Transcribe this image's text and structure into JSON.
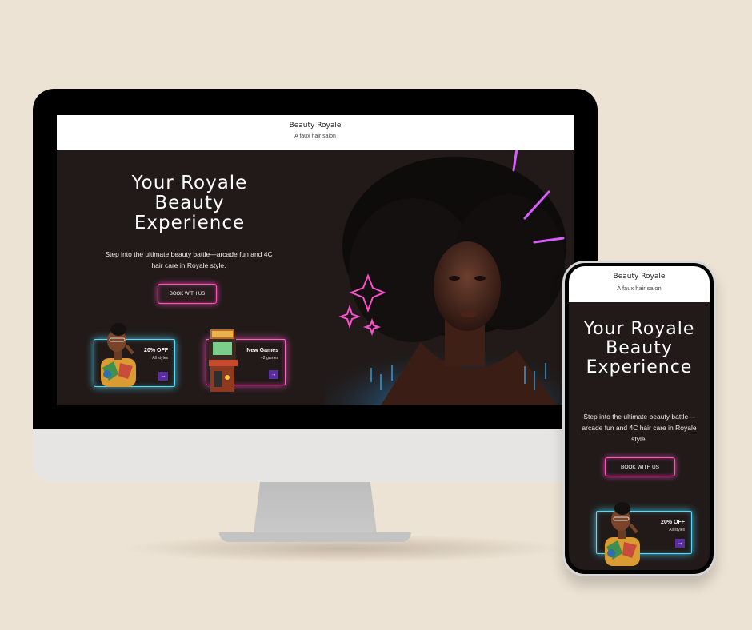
{
  "desktop": {
    "header": {
      "title": "Beauty Royale",
      "subtitle": "A faux hair salon"
    },
    "hero": {
      "title": "Your Royale Beauty Experience",
      "description": "Step into the ultimate beauty battle—arcade fun and 4C hair care in Royale style.",
      "cta_label": "BOOK WITH US"
    },
    "promos": [
      {
        "title": "20% OFF",
        "subtitle": "All styles",
        "arrow": "→"
      },
      {
        "title": "New Games",
        "subtitle": "+2 games",
        "arrow": "→"
      }
    ]
  },
  "mobile": {
    "header": {
      "title": "Beauty Royale",
      "subtitle": "A faux hair salon"
    },
    "hero": {
      "title": "Your Royale Beauty Experience",
      "description": "Step into the ultimate beauty battle—arcade fun and 4C hair care in Royale style.",
      "cta_label": "BOOK WITH US"
    },
    "promos": [
      {
        "title": "20% OFF",
        "subtitle": "All styles",
        "arrow": "→"
      }
    ]
  },
  "colors": {
    "page_background": "#ede3d4",
    "site_background": "#211a19",
    "neon_pink": "#ff56b9",
    "neon_cyan": "#52dcff",
    "arrow_purple": "#5a2ea0"
  },
  "icons": {
    "promo_arrow": "arrow-right-icon",
    "sparkle": "sparkle-icon",
    "neon_lines": "neon-burst-icon"
  }
}
